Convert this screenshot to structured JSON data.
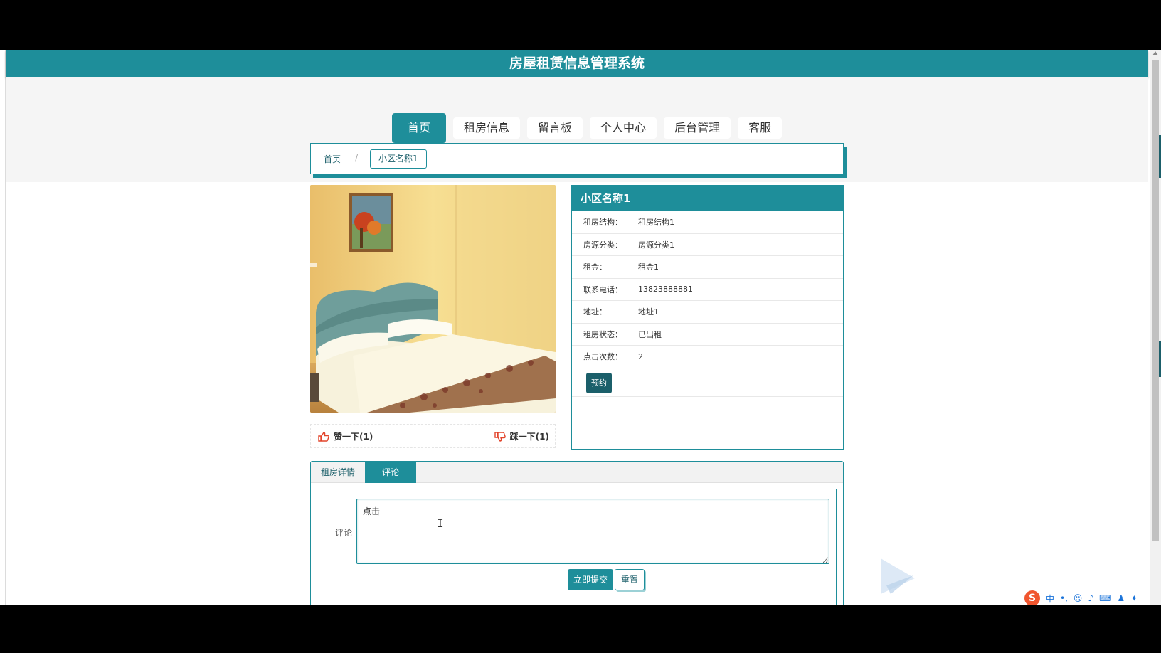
{
  "app": {
    "title": "房屋租赁信息管理系统"
  },
  "nav": {
    "items": [
      {
        "label": "首页"
      },
      {
        "label": "租房信息"
      },
      {
        "label": "留言板"
      },
      {
        "label": "个人中心"
      },
      {
        "label": "后台管理"
      },
      {
        "label": "客服"
      }
    ],
    "active": "首页"
  },
  "breadcrumb": {
    "home": "首页",
    "separator": "/",
    "current": "小区名称1"
  },
  "listing": {
    "name": "小区名称1",
    "fields": [
      {
        "label": "租房结构：",
        "value": "租房结构1"
      },
      {
        "label": "房源分类：",
        "value": "房源分类1"
      },
      {
        "label": "租金：",
        "value": "租金1"
      },
      {
        "label": "联系电话：",
        "value": "13823888881"
      },
      {
        "label": "地址：",
        "value": "地址1"
      },
      {
        "label": "租房状态：",
        "value": "已出租"
      },
      {
        "label": "点击次数：",
        "value": "2"
      }
    ],
    "book_label": "预约"
  },
  "votes": {
    "like_label": "赞一下(1)",
    "dislike_label": "踩一下(1)"
  },
  "tabs": {
    "items": [
      {
        "label": "租房详情"
      },
      {
        "label": "评论"
      }
    ],
    "active": "评论"
  },
  "comment": {
    "label": "评论",
    "value": "点击",
    "submit_label": "立即提交",
    "reset_label": "重置"
  },
  "ime": {
    "mode": "中"
  },
  "colors": {
    "primary": "#1e8e9a",
    "dark": "#1b5f6a",
    "like_icon": "#e2432a"
  }
}
